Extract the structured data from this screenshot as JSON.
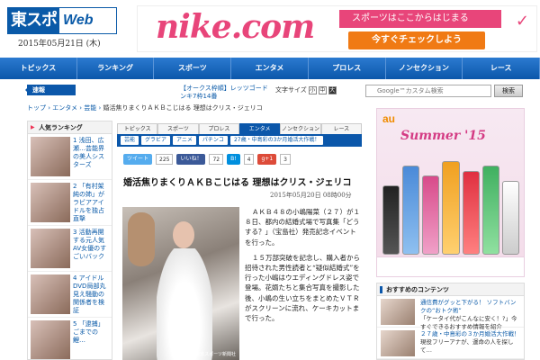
{
  "header": {
    "logo_jp": "東スポ",
    "logo_web": "Web",
    "date": "2015年05月21日 (木)"
  },
  "banner": {
    "brand": "nike.com",
    "strip_text": "スポーツはここからはじまる",
    "cta": "今すぐチェックしよう",
    "swoosh_icon": "nike-swoosh-icon",
    "colors": {
      "brand": "#e8457a",
      "cta": "#f07a14"
    }
  },
  "nav": [
    "トピックス",
    "ランキング",
    "スポーツ",
    "エンタメ",
    "プロレス",
    "ノンセクション",
    "レース"
  ],
  "flash": {
    "label": "速報",
    "ticker": "【オークス枠順】レッツゴードンキ7枠14番"
  },
  "font_size": {
    "label": "文字サイズ",
    "options": [
      "小",
      "中",
      "大"
    ],
    "selected": "大"
  },
  "search": {
    "placeholder": "Google™カスタム検索",
    "button": "検索"
  },
  "breadcrumb": {
    "items": [
      "トップ",
      "エンタメ",
      "芸能"
    ],
    "current": "婚活焦りまくりＡＫＢこじはる 理想はクリス・ジェリコ"
  },
  "ranking": {
    "title": "人気ランキング",
    "items": [
      {
        "text": "1 浅田、広瀬…芸能界の美人シスターズ"
      },
      {
        "text": "2 「有村架純の姉」がラビアアイドルを独占直撃"
      },
      {
        "text": "3 活動再開する元人気AV女優のすごいバック"
      },
      {
        "text": "4 アイドルDVD局部丸見え騒動の関係者を検証"
      },
      {
        "text": "5 「逮捕」ごまでの鯉…"
      }
    ]
  },
  "tabs": {
    "main": [
      "トピックス",
      "スポーツ",
      "プロレス",
      "エンタメ",
      "ノンセクション",
      "レース"
    ],
    "active": "エンタメ",
    "sub": [
      "芸能",
      "グラビア",
      "アニメ",
      "パチンコ",
      "27歳・中島彩の3か月婚活大作戦！"
    ]
  },
  "social": {
    "tweet_label": "ツイート",
    "tweet_count": "225",
    "like_label": "いいね！",
    "like_count": "72",
    "hatena_label": "B!",
    "hatena_count": "4",
    "gplus_label": "g+1",
    "gplus_count": "3"
  },
  "article": {
    "title": "婚活焦りまくりＡＫＢこじはる 理想はクリス・ジェリコ",
    "date": "2015年05月20日 08時00分",
    "photo_caption": "© 東京スポーツ新聞社",
    "paragraphs": [
      "ＡＫＢ４８の小嶋陽菜（２７）が１８日、都内の結婚式場で写真集「どうする？」（宝島社）発売記念イベントを行った。",
      "１５万部突破を記念し、購入者から招待された男性読者と“疑似結婚式”を行った小嶋はウエディングドレス姿で登場。花婿たちと集合写真を撮影した後、小嶋の生い立ちをまとめたＶＴＲがスクリーンに流れ、ケーキカットまで行った。"
    ]
  },
  "ad_au": {
    "brand": "au",
    "campaign": "Summer '15"
  },
  "recommend": {
    "title": "おすすめのコンテンツ",
    "items": [
      {
        "line1": "通信費がグッと下がる！ ソフトバンクの“おトク術”",
        "line2": "「ケータイ代がこんなに安く！?」今すぐできるおすすめ情報を紹介"
      },
      {
        "line1": "２７歳・中島彩の３か月婚活大作戦！",
        "line2": "現役フリーアナが、運命の人を探して…"
      }
    ]
  }
}
